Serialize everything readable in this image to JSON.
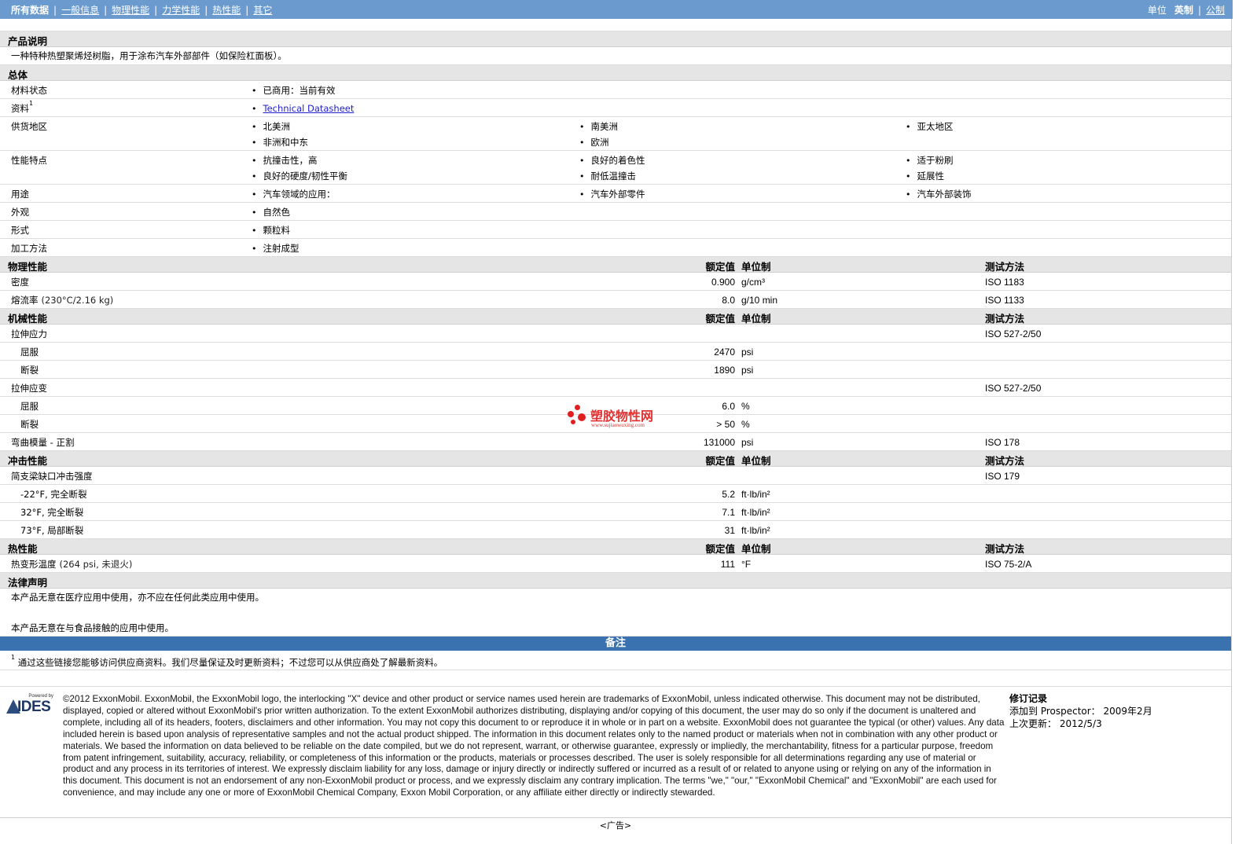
{
  "nav": {
    "items": [
      {
        "label": "所有数据",
        "active": true
      },
      {
        "label": "一般信息",
        "active": false
      },
      {
        "label": "物理性能",
        "active": false
      },
      {
        "label": "力学性能",
        "active": false
      },
      {
        "label": "热性能",
        "active": false
      },
      {
        "label": "其它",
        "active": false
      }
    ],
    "unit_label": "单位",
    "unit_english": "英制",
    "unit_metric": "公制"
  },
  "product": {
    "heading": "产品说明",
    "description": "一种特种热塑聚烯烃树脂，用于涂布汽车外部部件（如保险杠面板）。"
  },
  "general": {
    "heading": "总体",
    "rows": [
      {
        "label": "材料状态",
        "values": [
          "已商用：当前有效"
        ]
      },
      {
        "label": "资料",
        "sup": "1",
        "link": "Technical Datasheet"
      },
      {
        "label": "供货地区",
        "values": [
          "北美洲",
          "南美洲",
          "亚太地区",
          "非洲和中东",
          "欧洲"
        ]
      },
      {
        "label": "性能特点",
        "values": [
          "抗撞击性，高",
          "良好的着色性",
          "适于粉刷",
          "良好的硬度/韧性平衡",
          "耐低温撞击",
          "延展性"
        ]
      },
      {
        "label": "用途",
        "values": [
          "汽车领域的应用：",
          "汽车外部零件",
          "汽车外部装饰"
        ]
      },
      {
        "label": "外观",
        "values": [
          "自然色"
        ]
      },
      {
        "label": "形式",
        "values": [
          "颗粒料"
        ]
      },
      {
        "label": "加工方法",
        "values": [
          "注射成型"
        ]
      }
    ]
  },
  "headers": {
    "nominal": "额定值",
    "unit": "单位制",
    "method": "测试方法"
  },
  "physical": {
    "heading": "物理性能",
    "rows": [
      {
        "label": "密度",
        "value": "0.900",
        "unit": "g/cm³",
        "method": "ISO 1183"
      },
      {
        "label": "熔流率",
        "cond": "(230°C/2.16 kg)",
        "value": "8.0",
        "unit": "g/10 min",
        "method": "ISO 1133"
      }
    ]
  },
  "mechanical": {
    "heading": "机械性能",
    "rows": [
      {
        "label": "拉伸应力",
        "method": "ISO 527-2/50"
      },
      {
        "label": "屈服",
        "value": "2470",
        "unit": "psi"
      },
      {
        "label": "断裂",
        "value": "1890",
        "unit": "psi"
      },
      {
        "label": "拉伸应变",
        "method": "ISO 527-2/50"
      },
      {
        "label": "屈服",
        "value": "6.0",
        "unit": "%"
      },
      {
        "label": "断裂",
        "value": "> 50",
        "unit": "%"
      },
      {
        "label": "弯曲模量 - 正割",
        "value": "131000",
        "unit": "psi",
        "method": "ISO 178"
      }
    ]
  },
  "impact": {
    "heading": "冲击性能",
    "rows": [
      {
        "label": "简支梁缺口冲击强度",
        "method": "ISO 179"
      },
      {
        "label": "-22°F, 完全断裂",
        "value": "5.2",
        "unit": "ft·lb/in²"
      },
      {
        "label": "32°F, 完全断裂",
        "value": "7.1",
        "unit": "ft·lb/in²"
      },
      {
        "label": "73°F, 局部断裂",
        "value": "31",
        "unit": "ft·lb/in²"
      }
    ]
  },
  "thermal": {
    "heading": "热性能",
    "rows": [
      {
        "label": "热变形温度",
        "cond": "(264 psi, 未退火)",
        "value": "111",
        "unit": "°F",
        "method": "ISO 75-2/A"
      }
    ]
  },
  "legal": {
    "heading": "法律声明",
    "line1": "本产品无意在医疗应用中使用，亦不应在任何此类应用中使用。",
    "line2": "本产品无意在与食品接触的应用中使用。"
  },
  "notes": {
    "heading": "备注",
    "sup": "1",
    "footnote": "通过这些链接您能够访问供应商资料。我们尽量保证及时更新资料；不过您可以从供应商处了解最新资料。"
  },
  "footer": {
    "logo_powered": "Powered by",
    "logo_text": "IDES",
    "copyright": "©2012 ExxonMobil. ExxonMobil, the ExxonMobil logo, the interlocking \"X\" device and other product or service names used herein are trademarks of ExxonMobil, unless indicated otherwise. This document may not be distributed, displayed, copied or altered without ExxonMobil's prior written authorization. To the extent ExxonMobil authorizes distributing, displaying and/or copying of this document, the user may do so only if the document is unaltered and complete, including all of its headers, footers, disclaimers and other information. You may not copy this document to or reproduce it in whole or in part on a website. ExxonMobil does not guarantee the typical (or other) values. Any data included herein is based upon analysis of representative samples and not the actual product shipped. The information in this document relates only to the named product or materials when not in combination with any other product or materials. We based the information on data believed to be reliable on the date compiled, but we do not represent, warrant, or otherwise guarantee, expressly or impliedly, the merchantability, fitness for a particular purpose, freedom from patent infringement, suitability, accuracy, reliability, or completeness of this information or the products, materials or processes described. The user is solely responsible for all determinations regarding any use of material or product and any process in its territories of interest. We expressly disclaim liability for any loss, damage or injury directly or indirectly suffered or incurred as a result of or related to anyone using or relying on any of the information in this document. This document is not an endorsement of any non-ExxonMobil product or process, and we expressly disclaim any contrary implication. The terms \"we,\" \"our,\" \"ExxonMobil Chemical\" and \"ExxonMobil\" are each used for convenience, and may include any one or more of ExxonMobil Chemical Company, Exxon Mobil Corporation, or any affiliate either directly or indirectly stewarded.",
    "revision_title": "修订记录",
    "added_label": "添加到 Prospector：",
    "added_value": "2009年2月",
    "updated_label": "上次更新：",
    "updated_value": "2012/5/3"
  },
  "ad": "<广告>",
  "watermark": {
    "name": "塑胶物性网",
    "url": "www.sujiaowuxing.com"
  }
}
